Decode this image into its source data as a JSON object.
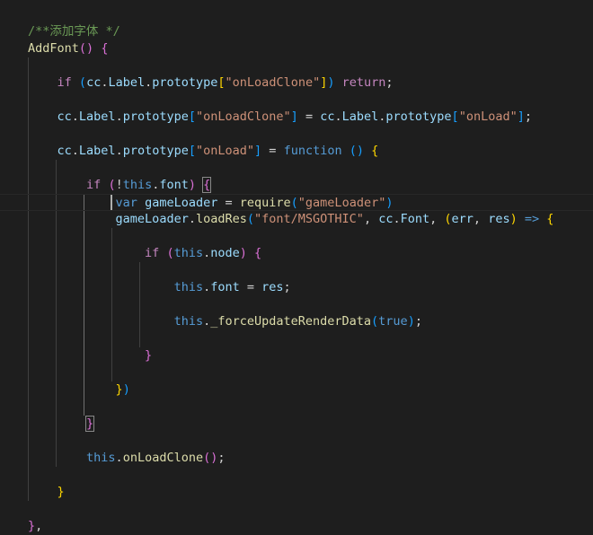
{
  "editor": {
    "theme_colors": {
      "background": "#1e1e1e",
      "comment": "#6a9955",
      "function": "#dcdcaa",
      "control_keyword": "#c586c0",
      "keyword": "#569cd6",
      "variable": "#9cdcfe",
      "string": "#ce9178",
      "text": "#d4d4d4",
      "bracket_level1": "#ffd700",
      "bracket_level2": "#da70d6",
      "bracket_level3": "#179fff"
    },
    "lines": [
      {
        "tokens": [
          {
            "t": "/**添加字体 */",
            "k": "c"
          }
        ]
      },
      {
        "tokens": [
          {
            "t": "AddFont",
            "k": "fn"
          },
          {
            "t": "()",
            "k": "b2"
          },
          {
            "t": " ",
            "k": "tx"
          },
          {
            "t": "{",
            "k": "b2"
          }
        ]
      },
      {
        "tokens": []
      },
      {
        "tokens": [
          {
            "t": "    ",
            "k": "tx"
          },
          {
            "t": "if",
            "k": "kw"
          },
          {
            "t": " ",
            "k": "tx"
          },
          {
            "t": "(",
            "k": "b3"
          },
          {
            "t": "cc",
            "k": "vr"
          },
          {
            "t": ".",
            "k": "tx"
          },
          {
            "t": "Label",
            "k": "vr"
          },
          {
            "t": ".",
            "k": "tx"
          },
          {
            "t": "prototype",
            "k": "vr"
          },
          {
            "t": "[",
            "k": "b1"
          },
          {
            "t": "\"onLoadClone\"",
            "k": "st"
          },
          {
            "t": "]",
            "k": "b1"
          },
          {
            "t": ")",
            "k": "b3"
          },
          {
            "t": " ",
            "k": "tx"
          },
          {
            "t": "return",
            "k": "kw"
          },
          {
            "t": ";",
            "k": "tx"
          }
        ]
      },
      {
        "tokens": []
      },
      {
        "tokens": [
          {
            "t": "    ",
            "k": "tx"
          },
          {
            "t": "cc",
            "k": "vr"
          },
          {
            "t": ".",
            "k": "tx"
          },
          {
            "t": "Label",
            "k": "vr"
          },
          {
            "t": ".",
            "k": "tx"
          },
          {
            "t": "prototype",
            "k": "vr"
          },
          {
            "t": "[",
            "k": "b3"
          },
          {
            "t": "\"onLoadClone\"",
            "k": "st"
          },
          {
            "t": "]",
            "k": "b3"
          },
          {
            "t": " = ",
            "k": "tx"
          },
          {
            "t": "cc",
            "k": "vr"
          },
          {
            "t": ".",
            "k": "tx"
          },
          {
            "t": "Label",
            "k": "vr"
          },
          {
            "t": ".",
            "k": "tx"
          },
          {
            "t": "prototype",
            "k": "vr"
          },
          {
            "t": "[",
            "k": "b3"
          },
          {
            "t": "\"onLoad\"",
            "k": "st"
          },
          {
            "t": "]",
            "k": "b3"
          },
          {
            "t": ";",
            "k": "tx"
          }
        ]
      },
      {
        "tokens": []
      },
      {
        "tokens": [
          {
            "t": "    ",
            "k": "tx"
          },
          {
            "t": "cc",
            "k": "vr"
          },
          {
            "t": ".",
            "k": "tx"
          },
          {
            "t": "Label",
            "k": "vr"
          },
          {
            "t": ".",
            "k": "tx"
          },
          {
            "t": "prototype",
            "k": "vr"
          },
          {
            "t": "[",
            "k": "b3"
          },
          {
            "t": "\"onLoad\"",
            "k": "st"
          },
          {
            "t": "]",
            "k": "b3"
          },
          {
            "t": " = ",
            "k": "tx"
          },
          {
            "t": "function",
            "k": "bl"
          },
          {
            "t": " ",
            "k": "tx"
          },
          {
            "t": "()",
            "k": "b3"
          },
          {
            "t": " ",
            "k": "tx"
          },
          {
            "t": "{",
            "k": "b1"
          }
        ]
      },
      {
        "tokens": []
      },
      {
        "tokens": [
          {
            "t": "        ",
            "k": "tx"
          },
          {
            "t": "if",
            "k": "kw"
          },
          {
            "t": " ",
            "k": "tx"
          },
          {
            "t": "(",
            "k": "b2"
          },
          {
            "t": "!",
            "k": "tx"
          },
          {
            "t": "this",
            "k": "bl"
          },
          {
            "t": ".",
            "k": "tx"
          },
          {
            "t": "font",
            "k": "vr"
          },
          {
            "t": ")",
            "k": "b2"
          },
          {
            "t": " ",
            "k": "tx"
          },
          {
            "t": "{",
            "k": "b2",
            "bm": true
          }
        ]
      },
      {
        "tokens": [
          {
            "t": "            ",
            "k": "tx"
          },
          {
            "t": "var",
            "k": "bl"
          },
          {
            "t": " ",
            "k": "tx"
          },
          {
            "t": "gameLoader",
            "k": "vr"
          },
          {
            "t": " = ",
            "k": "tx"
          },
          {
            "t": "require",
            "k": "fn"
          },
          {
            "t": "(",
            "k": "b3"
          },
          {
            "t": "\"gameLoader\"",
            "k": "st"
          },
          {
            "t": ")",
            "k": "b3"
          }
        ]
      },
      {
        "tokens": [
          {
            "t": "            ",
            "k": "tx"
          },
          {
            "t": "gameLoader",
            "k": "vr"
          },
          {
            "t": ".",
            "k": "tx"
          },
          {
            "t": "loadRes",
            "k": "fn"
          },
          {
            "t": "(",
            "k": "b3"
          },
          {
            "t": "\"font/MSGOTHIC\"",
            "k": "st"
          },
          {
            "t": ", ",
            "k": "tx"
          },
          {
            "t": "cc",
            "k": "vr"
          },
          {
            "t": ".",
            "k": "tx"
          },
          {
            "t": "Font",
            "k": "vr"
          },
          {
            "t": ", ",
            "k": "tx"
          },
          {
            "t": "(",
            "k": "b1"
          },
          {
            "t": "err",
            "k": "vr"
          },
          {
            "t": ", ",
            "k": "tx"
          },
          {
            "t": "res",
            "k": "vr"
          },
          {
            "t": ")",
            "k": "b1"
          },
          {
            "t": " ",
            "k": "tx"
          },
          {
            "t": "=>",
            "k": "bl"
          },
          {
            "t": " ",
            "k": "tx"
          },
          {
            "t": "{",
            "k": "b1"
          }
        ]
      },
      {
        "tokens": []
      },
      {
        "tokens": [
          {
            "t": "                ",
            "k": "tx"
          },
          {
            "t": "if",
            "k": "kw"
          },
          {
            "t": " ",
            "k": "tx"
          },
          {
            "t": "(",
            "k": "b2"
          },
          {
            "t": "this",
            "k": "bl"
          },
          {
            "t": ".",
            "k": "tx"
          },
          {
            "t": "node",
            "k": "vr"
          },
          {
            "t": ")",
            "k": "b2"
          },
          {
            "t": " ",
            "k": "tx"
          },
          {
            "t": "{",
            "k": "b2"
          }
        ]
      },
      {
        "tokens": []
      },
      {
        "tokens": [
          {
            "t": "                    ",
            "k": "tx"
          },
          {
            "t": "this",
            "k": "bl"
          },
          {
            "t": ".",
            "k": "tx"
          },
          {
            "t": "font",
            "k": "vr"
          },
          {
            "t": " = ",
            "k": "tx"
          },
          {
            "t": "res",
            "k": "vr"
          },
          {
            "t": ";",
            "k": "tx"
          }
        ]
      },
      {
        "tokens": []
      },
      {
        "tokens": [
          {
            "t": "                    ",
            "k": "tx"
          },
          {
            "t": "this",
            "k": "bl"
          },
          {
            "t": ".",
            "k": "tx"
          },
          {
            "t": "_forceUpdateRenderData",
            "k": "fn"
          },
          {
            "t": "(",
            "k": "b3"
          },
          {
            "t": "true",
            "k": "bl"
          },
          {
            "t": ")",
            "k": "b3"
          },
          {
            "t": ";",
            "k": "tx"
          }
        ]
      },
      {
        "tokens": []
      },
      {
        "tokens": [
          {
            "t": "                ",
            "k": "tx"
          },
          {
            "t": "}",
            "k": "b2"
          }
        ]
      },
      {
        "tokens": []
      },
      {
        "tokens": [
          {
            "t": "            ",
            "k": "tx"
          },
          {
            "t": "}",
            "k": "b1"
          },
          {
            "t": ")",
            "k": "b3"
          }
        ]
      },
      {
        "tokens": []
      },
      {
        "tokens": [
          {
            "t": "        ",
            "k": "tx"
          },
          {
            "t": "}",
            "k": "b2",
            "bm": true
          }
        ]
      },
      {
        "tokens": []
      },
      {
        "tokens": [
          {
            "t": "        ",
            "k": "tx"
          },
          {
            "t": "this",
            "k": "bl"
          },
          {
            "t": ".",
            "k": "tx"
          },
          {
            "t": "onLoadClone",
            "k": "fn"
          },
          {
            "t": "()",
            "k": "b2"
          },
          {
            "t": ";",
            "k": "tx"
          }
        ]
      },
      {
        "tokens": []
      },
      {
        "tokens": [
          {
            "t": "    ",
            "k": "tx"
          },
          {
            "t": "}",
            "k": "b1"
          }
        ]
      },
      {
        "tokens": []
      },
      {
        "tokens": [
          {
            "t": "}",
            "k": "b2"
          },
          {
            "t": ",",
            "k": "tx"
          }
        ]
      }
    ]
  }
}
